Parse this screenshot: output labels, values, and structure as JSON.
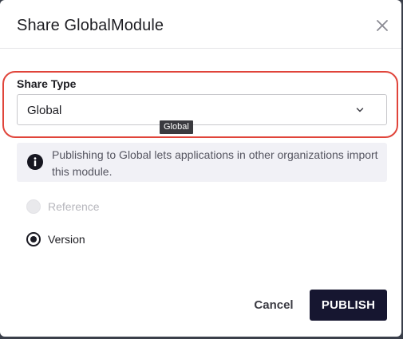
{
  "dialog": {
    "title": "Share GlobalModule",
    "close_icon": "close-icon"
  },
  "share_type": {
    "label": "Share Type",
    "selected": "Global",
    "tooltip": "Global",
    "highlight_color": "#e0443a"
  },
  "info": {
    "icon": "info-icon",
    "text": "Publishing to Global lets applications in other organizations import this module."
  },
  "options": {
    "reference": {
      "label": "Reference",
      "disabled": true,
      "checked": false
    },
    "version": {
      "label": "Version",
      "disabled": false,
      "checked": true
    }
  },
  "actions": {
    "cancel_label": "Cancel",
    "publish_label": "PUBLISH",
    "publish_color": "#161630"
  }
}
